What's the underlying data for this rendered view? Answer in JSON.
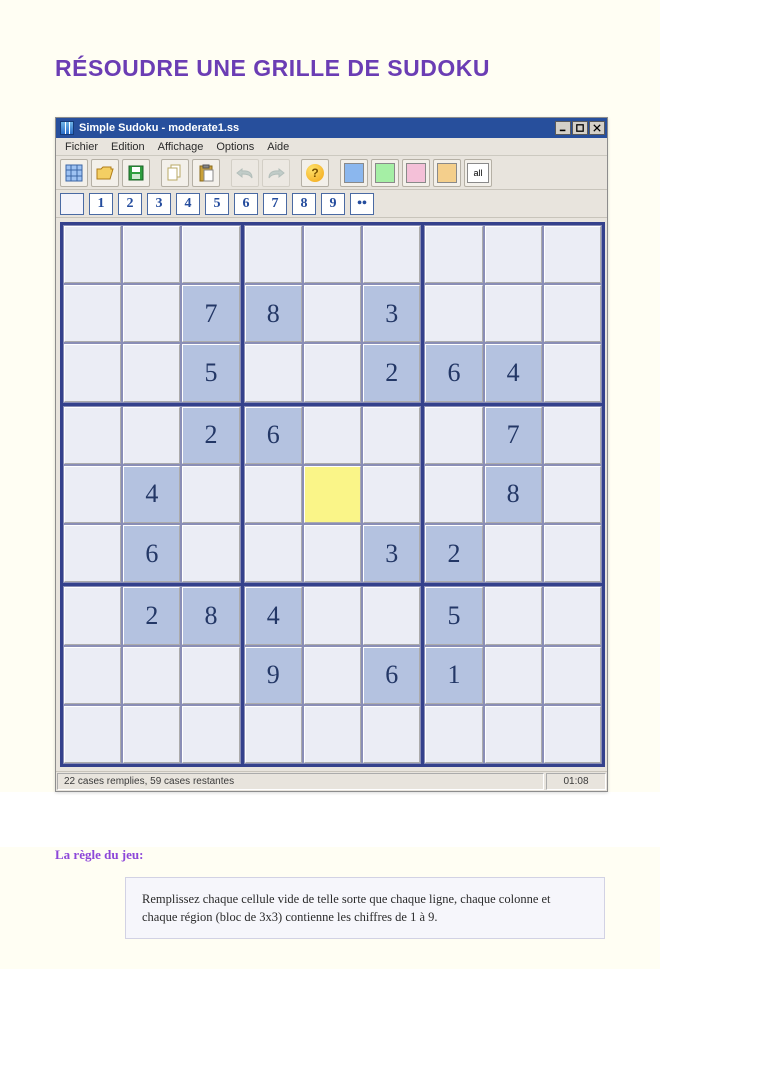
{
  "doc": {
    "title": "RÉSOUDRE UNE GRILLE DE SUDOKU"
  },
  "app": {
    "title": "Simple Sudoku - moderate1.ss",
    "menu": [
      "Fichier",
      "Edition",
      "Affichage",
      "Options",
      "Aide"
    ],
    "toolbar_all_label": "all",
    "numbers": [
      "",
      "1",
      "2",
      "3",
      "4",
      "5",
      "6",
      "7",
      "8",
      "9",
      "••"
    ],
    "status_left": "22 cases remplies, 59 cases restantes",
    "status_right": "01:08"
  },
  "sudoku": {
    "selected": [
      4,
      4
    ],
    "grid": [
      [
        null,
        null,
        null,
        null,
        null,
        null,
        null,
        null,
        null
      ],
      [
        null,
        null,
        7,
        8,
        null,
        3,
        null,
        null,
        null
      ],
      [
        null,
        null,
        5,
        null,
        null,
        2,
        6,
        4,
        null
      ],
      [
        null,
        null,
        2,
        6,
        null,
        null,
        null,
        7,
        null
      ],
      [
        null,
        4,
        null,
        null,
        null,
        null,
        null,
        8,
        null
      ],
      [
        null,
        6,
        null,
        null,
        null,
        3,
        2,
        null,
        null
      ],
      [
        null,
        2,
        8,
        4,
        null,
        null,
        5,
        null,
        null
      ],
      [
        null,
        null,
        null,
        9,
        null,
        6,
        1,
        null,
        null
      ],
      [
        null,
        null,
        null,
        null,
        null,
        null,
        null,
        null,
        null
      ]
    ]
  },
  "rules": {
    "heading": "La règle du jeu:",
    "text": "Remplissez chaque cellule vide de telle sorte que chaque ligne, chaque colonne et chaque région (bloc de 3x3) contienne les chiffres de 1 à 9."
  },
  "chart_data": {
    "type": "table",
    "title": "Sudoku grid (initial givens), 9×9, null = empty",
    "grid": [
      [
        null,
        null,
        null,
        null,
        null,
        null,
        null,
        null,
        null
      ],
      [
        null,
        null,
        7,
        8,
        null,
        3,
        null,
        null,
        null
      ],
      [
        null,
        null,
        5,
        null,
        null,
        2,
        6,
        4,
        null
      ],
      [
        null,
        null,
        2,
        6,
        null,
        null,
        null,
        7,
        null
      ],
      [
        null,
        4,
        null,
        null,
        null,
        null,
        null,
        8,
        null
      ],
      [
        null,
        6,
        null,
        null,
        null,
        3,
        2,
        null,
        null
      ],
      [
        null,
        2,
        8,
        4,
        null,
        null,
        5,
        null,
        null
      ],
      [
        null,
        null,
        null,
        9,
        null,
        6,
        1,
        null,
        null
      ],
      [
        null,
        null,
        null,
        null,
        null,
        null,
        null,
        null,
        null
      ]
    ],
    "selected_cell": {
      "row": 4,
      "col": 4
    }
  }
}
